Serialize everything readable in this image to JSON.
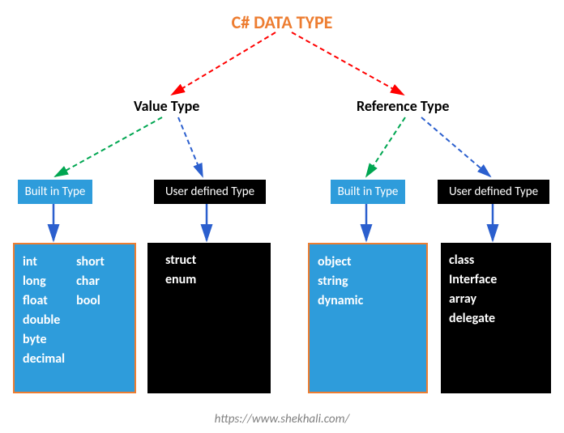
{
  "title": "C# DATA TYPE",
  "value_type": {
    "label": "Value Type",
    "builtin": {
      "label": "Built in Type",
      "items_col1": [
        "int",
        "long",
        "float",
        "double",
        "byte",
        "decimal"
      ],
      "items_col2": [
        "short",
        "char",
        "bool"
      ]
    },
    "userdef": {
      "label": "User defined Type",
      "items": [
        "struct",
        "enum"
      ]
    }
  },
  "reference_type": {
    "label": "Reference Type",
    "builtin": {
      "label": "Built in Type",
      "items": [
        "object",
        "string",
        "dynamic"
      ]
    },
    "userdef": {
      "label": "User defined Type",
      "items": [
        "class",
        "Interface",
        "array",
        "delegate"
      ]
    }
  },
  "footer": "https://www.shekhali.com/",
  "chart_data": {
    "type": "tree",
    "root": "C# DATA TYPE",
    "children": [
      {
        "name": "Value Type",
        "children": [
          {
            "name": "Built in Type",
            "leaves": [
              "int",
              "long",
              "float",
              "double",
              "byte",
              "decimal",
              "short",
              "char",
              "bool"
            ]
          },
          {
            "name": "User defined Type",
            "leaves": [
              "struct",
              "enum"
            ]
          }
        ]
      },
      {
        "name": "Reference Type",
        "children": [
          {
            "name": "Built in Type",
            "leaves": [
              "object",
              "string",
              "dynamic"
            ]
          },
          {
            "name": "User defined Type",
            "leaves": [
              "class",
              "Interface",
              "array",
              "delegate"
            ]
          }
        ]
      }
    ]
  }
}
